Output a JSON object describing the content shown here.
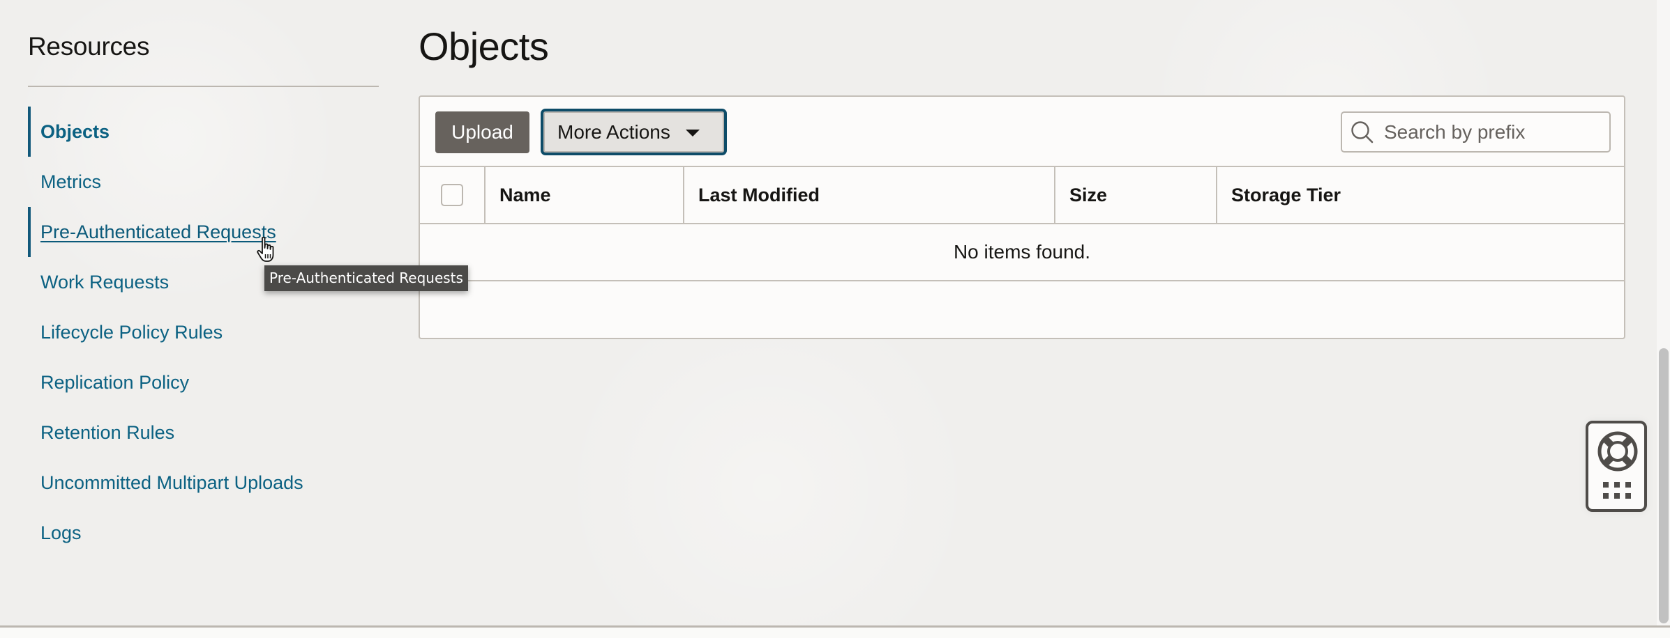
{
  "sidebar": {
    "title": "Resources",
    "items": [
      {
        "label": "Objects",
        "state": "active"
      },
      {
        "label": "Metrics",
        "state": "default"
      },
      {
        "label": "Pre-Authenticated Requests",
        "state": "hover"
      },
      {
        "label": "Work Requests",
        "state": "default"
      },
      {
        "label": "Lifecycle Policy Rules",
        "state": "default"
      },
      {
        "label": "Replication Policy",
        "state": "default"
      },
      {
        "label": "Retention Rules",
        "state": "default"
      },
      {
        "label": "Uncommitted Multipart Uploads",
        "state": "default"
      },
      {
        "label": "Logs",
        "state": "default"
      }
    ]
  },
  "tooltip": {
    "text": "Pre-Authenticated Requests"
  },
  "main": {
    "title": "Objects",
    "toolbar": {
      "upload_label": "Upload",
      "more_actions_label": "More Actions",
      "search_placeholder": "Search by prefix",
      "search_value": ""
    },
    "table": {
      "columns": [
        "Name",
        "Last Modified",
        "Size",
        "Storage Tier"
      ],
      "rows": [],
      "empty_message": "No items found."
    }
  },
  "help_widget": {
    "icons": [
      "lifebuoy-icon",
      "apps-grid-icon"
    ]
  },
  "colors": {
    "link": "#0b6182",
    "active_indicator": "#11587a",
    "primary_button": "#67625d",
    "focus_ring": "#0e4c68",
    "tooltip_bg": "#4b4a48"
  }
}
